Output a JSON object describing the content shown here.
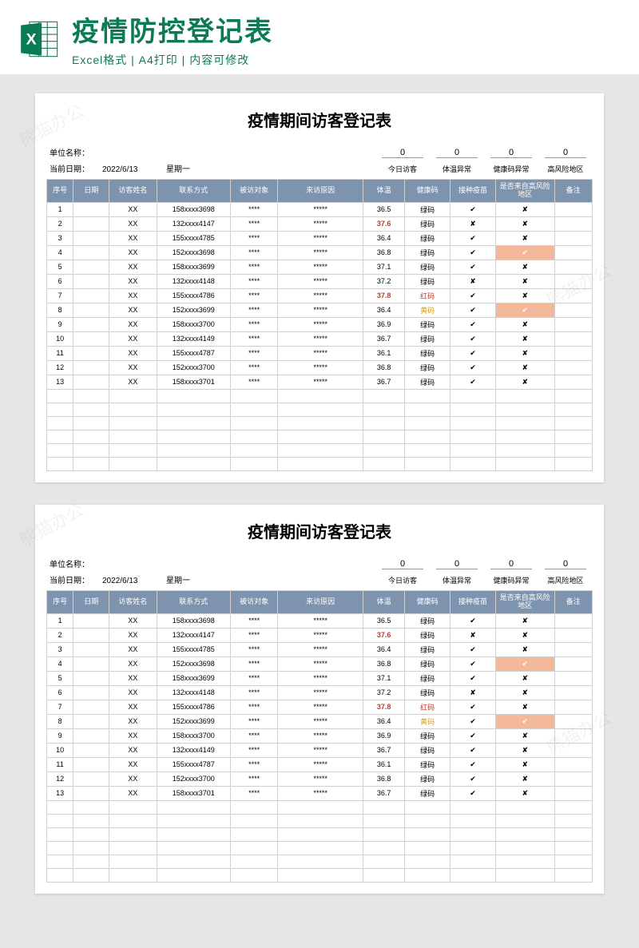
{
  "banner": {
    "title": "疫情防控登记表",
    "subtitle": "Excel格式 | A4打印 | 内容可修改"
  },
  "sheet": {
    "title": "疫情期间访客登记表",
    "meta": {
      "unitLabel": "单位名称：",
      "unitValue": "",
      "dateLabel": "当前日期：",
      "dateValue": "2022/6/13",
      "weekday": "星期一"
    },
    "stats": [
      {
        "num": "0",
        "label": "今日访客"
      },
      {
        "num": "0",
        "label": "体温异常"
      },
      {
        "num": "0",
        "label": "健康码异常"
      },
      {
        "num": "0",
        "label": "高风险地区"
      }
    ],
    "headers": [
      "序号",
      "日期",
      "访客姓名",
      "联系方式",
      "被访对象",
      "来访原因",
      "体温",
      "健康码",
      "接种疫苗",
      "是否来自高风险地区",
      "备注"
    ]
  },
  "chart_data": {
    "type": "table",
    "title": "疫情期间访客登记表",
    "columns": [
      "序号",
      "日期",
      "访客姓名",
      "联系方式",
      "被访对象",
      "来访原因",
      "体温",
      "健康码",
      "接种疫苗",
      "是否来自高风险地区",
      "备注"
    ],
    "rows": [
      {
        "idx": 1,
        "date": "",
        "name": "XX",
        "phone": "158xxxx3698",
        "target": "****",
        "reason": "*****",
        "temp": 36.5,
        "code": "绿码",
        "vaccine": "✔",
        "risk": "✘",
        "note": ""
      },
      {
        "idx": 2,
        "date": "",
        "name": "XX",
        "phone": "132xxxx4147",
        "target": "****",
        "reason": "*****",
        "temp": 37.6,
        "code": "绿码",
        "vaccine": "✘",
        "risk": "✘",
        "note": ""
      },
      {
        "idx": 3,
        "date": "",
        "name": "XX",
        "phone": "155xxxx4785",
        "target": "****",
        "reason": "*****",
        "temp": 36.4,
        "code": "绿码",
        "vaccine": "✔",
        "risk": "✘",
        "note": ""
      },
      {
        "idx": 4,
        "date": "",
        "name": "XX",
        "phone": "152xxxx3698",
        "target": "****",
        "reason": "*****",
        "temp": 36.8,
        "code": "绿码",
        "vaccine": "✔",
        "risk": "✔",
        "note": "",
        "riskHl": true
      },
      {
        "idx": 5,
        "date": "",
        "name": "XX",
        "phone": "158xxxx3699",
        "target": "****",
        "reason": "*****",
        "temp": 37.1,
        "code": "绿码",
        "vaccine": "✔",
        "risk": "✘",
        "note": ""
      },
      {
        "idx": 6,
        "date": "",
        "name": "XX",
        "phone": "132xxxx4148",
        "target": "****",
        "reason": "*****",
        "temp": 37.2,
        "code": "绿码",
        "vaccine": "✘",
        "risk": "✘",
        "note": ""
      },
      {
        "idx": 7,
        "date": "",
        "name": "XX",
        "phone": "155xxxx4786",
        "target": "****",
        "reason": "*****",
        "temp": 37.8,
        "code": "红码",
        "vaccine": "✔",
        "risk": "✘",
        "note": ""
      },
      {
        "idx": 8,
        "date": "",
        "name": "XX",
        "phone": "152xxxx3699",
        "target": "****",
        "reason": "*****",
        "temp": 36.4,
        "code": "黄码",
        "vaccine": "✔",
        "risk": "✔",
        "note": "",
        "riskHl": true
      },
      {
        "idx": 9,
        "date": "",
        "name": "XX",
        "phone": "158xxxx3700",
        "target": "****",
        "reason": "*****",
        "temp": 36.9,
        "code": "绿码",
        "vaccine": "✔",
        "risk": "✘",
        "note": ""
      },
      {
        "idx": 10,
        "date": "",
        "name": "XX",
        "phone": "132xxxx4149",
        "target": "****",
        "reason": "*****",
        "temp": 36.7,
        "code": "绿码",
        "vaccine": "✔",
        "risk": "✘",
        "note": ""
      },
      {
        "idx": 11,
        "date": "",
        "name": "XX",
        "phone": "155xxxx4787",
        "target": "****",
        "reason": "*****",
        "temp": 36.1,
        "code": "绿码",
        "vaccine": "✔",
        "risk": "✘",
        "note": ""
      },
      {
        "idx": 12,
        "date": "",
        "name": "XX",
        "phone": "152xxxx3700",
        "target": "****",
        "reason": "*****",
        "temp": 36.8,
        "code": "绿码",
        "vaccine": "✔",
        "risk": "✘",
        "note": ""
      },
      {
        "idx": 13,
        "date": "",
        "name": "XX",
        "phone": "158xxxx3701",
        "target": "****",
        "reason": "*****",
        "temp": 36.7,
        "code": "绿码",
        "vaccine": "✔",
        "risk": "✘",
        "note": ""
      }
    ],
    "emptyRows": 6
  },
  "watermark": "熊猫办公"
}
